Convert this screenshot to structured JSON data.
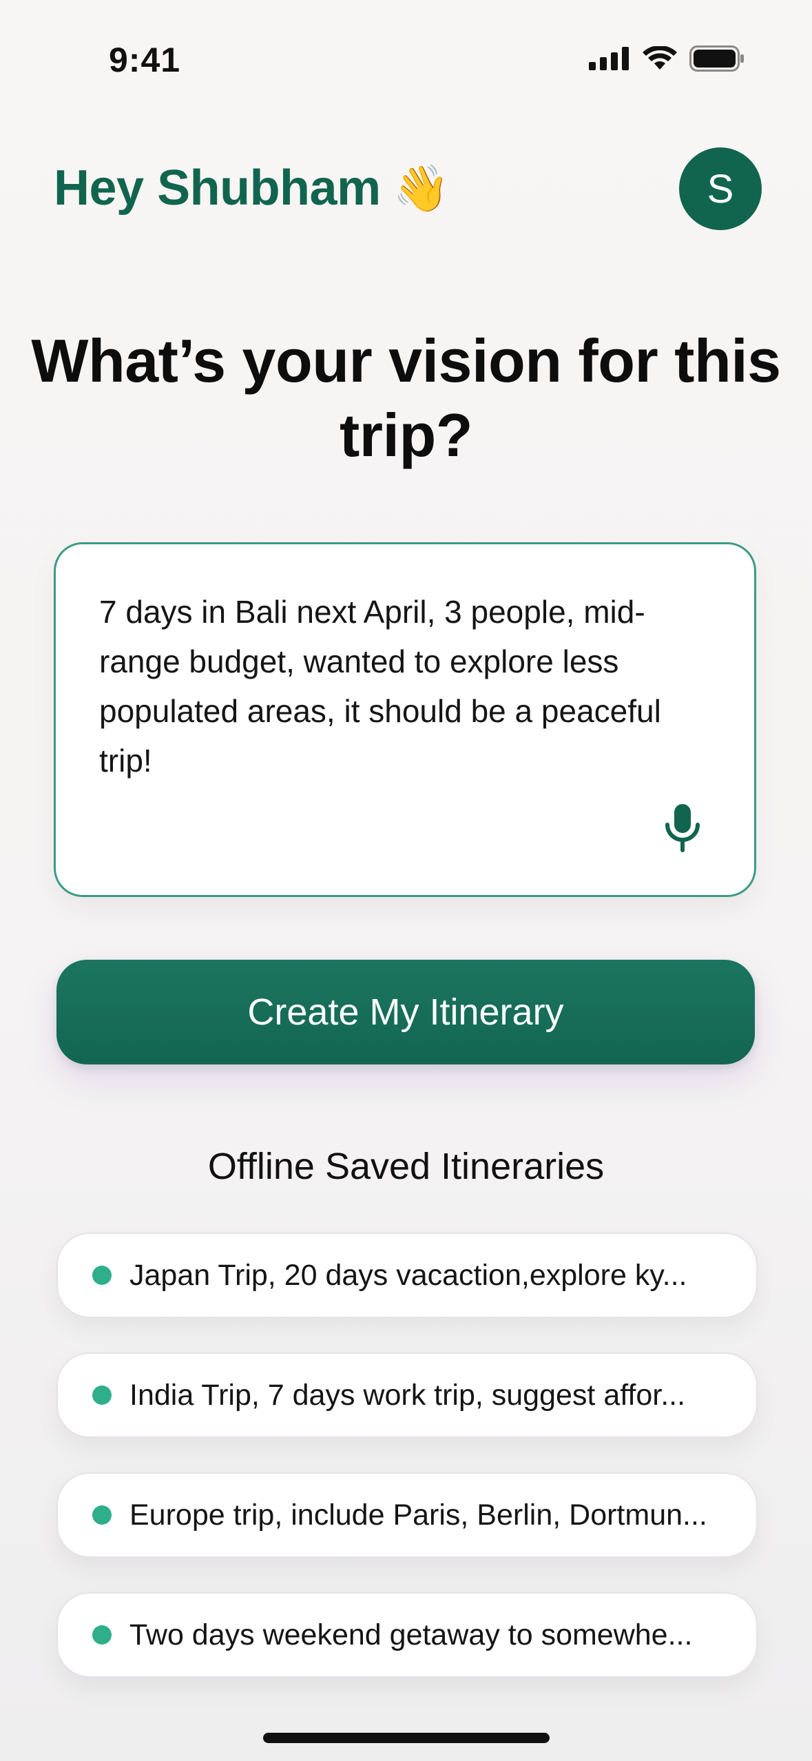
{
  "status_bar": {
    "time": "9:41",
    "icons": [
      "cellular-signal-icon",
      "wifi-icon",
      "battery-icon"
    ]
  },
  "header": {
    "greeting": "Hey Shubham",
    "greeting_emoji": "👋",
    "avatar_initial": "S"
  },
  "main": {
    "question": "What’s your vision for this trip?",
    "prompt": {
      "value": "7 days in Bali next April, 3 people, mid-range budget, wanted to explore less populated areas, it should be a peaceful trip!",
      "mic_icon": "microphone-icon"
    },
    "cta_label": "Create My Itinerary"
  },
  "saved": {
    "title": "Offline Saved Itineraries",
    "items": [
      {
        "label": "Japan Trip, 20 days vacaction,explore ky..."
      },
      {
        "label": "India Trip, 7 days work trip, suggest affor..."
      },
      {
        "label": "Europe trip, include Paris, Berlin, Dortmun..."
      },
      {
        "label": "Two days weekend getaway to somewhe..."
      }
    ]
  },
  "colors": {
    "brand": "#11654e",
    "accent_dot": "#2fae8a",
    "prompt_border": "#3a9c84"
  }
}
